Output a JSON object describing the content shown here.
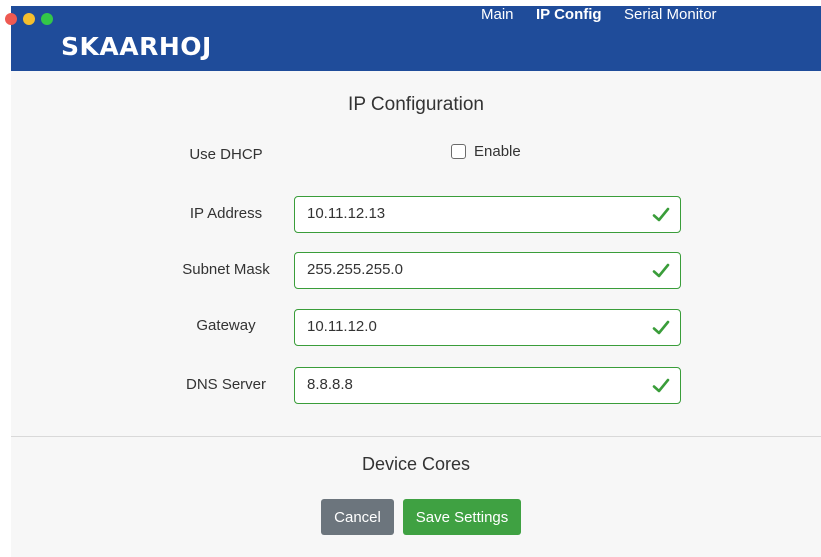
{
  "window": {
    "brand": "SKAARHOJ"
  },
  "nav": {
    "items": [
      "Main",
      "IP Config",
      "Serial Monitor"
    ]
  },
  "page": {
    "title": "IP Configuration"
  },
  "dhcp": {
    "label": "Use DHCP",
    "checkbox_label": "Enable",
    "checked": false
  },
  "fields": [
    {
      "label": "IP Address",
      "value": "10.11.12.13",
      "valid": true
    },
    {
      "label": "Subnet Mask",
      "value": "255.255.255.0",
      "valid": true
    },
    {
      "label": "Gateway",
      "value": "10.11.12.0",
      "valid": true
    },
    {
      "label": "DNS Server",
      "value": "8.8.8.8",
      "valid": true
    }
  ],
  "section": {
    "title": "Device Cores"
  },
  "buttons": {
    "cancel": "Cancel",
    "save": "Save Settings"
  },
  "colors": {
    "header": "#1f4c9a",
    "valid": "#3a9d3a",
    "save": "#3fa142",
    "cancel": "#6c757d"
  },
  "icons": {
    "valid": "checkmark-icon"
  }
}
